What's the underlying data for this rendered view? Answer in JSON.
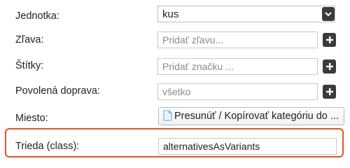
{
  "form": {
    "unit": {
      "label": "Jednotka:",
      "value": "kus",
      "icon": "chevron-down-icon"
    },
    "discount": {
      "label": "Zľava:",
      "placeholder": "Pridať zľavu...",
      "add_icon": "plus-icon"
    },
    "tags": {
      "label": "Štítky:",
      "placeholder": "Pridať značku ...",
      "add_icon": "plus-icon"
    },
    "shipping": {
      "label": "Povolená doprava:",
      "value": "všetko",
      "add_icon": "plus-icon"
    },
    "location": {
      "label": "Miesto:",
      "button_label": "Presunúť / Kopírovať kategóriu do ...",
      "icon": "document-icon"
    },
    "css_class": {
      "label": "Trieda (class):",
      "value": "alternativesAsVariants"
    }
  },
  "colors": {
    "highlight_border": "#e0552a",
    "button_bg": "#3b3b3b"
  }
}
